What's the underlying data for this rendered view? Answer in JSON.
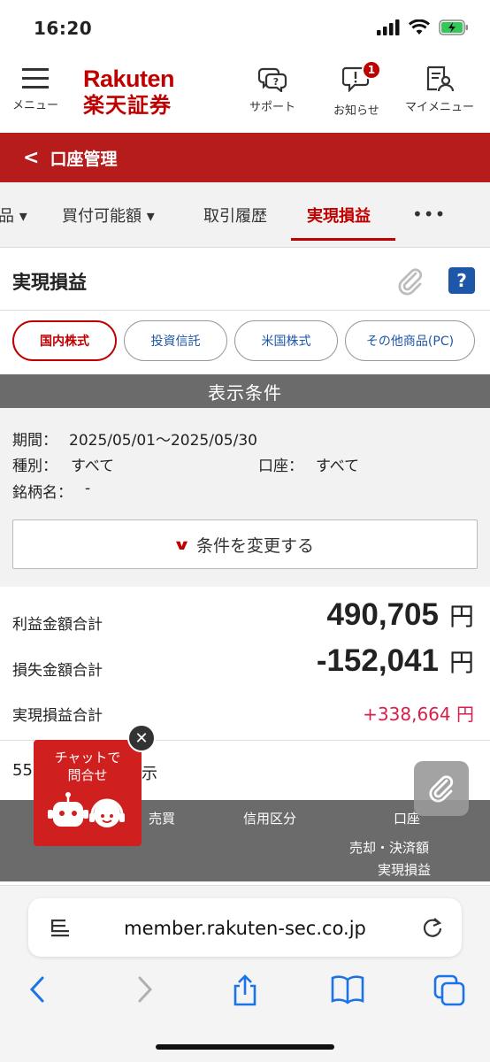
{
  "status": {
    "time": "16:20"
  },
  "header": {
    "menu_label": "メニュー",
    "logo_en": "Rakuten",
    "logo_jp": "楽天証券",
    "support_label": "サポート",
    "notice_label": "お知らせ",
    "notice_badge": "1",
    "mymenu_label": "マイメニュー"
  },
  "page_bar": {
    "title": "口座管理"
  },
  "tabs": [
    {
      "label": "品 ▾"
    },
    {
      "label": "買付可能額 ▾"
    },
    {
      "label": "取引履歴"
    },
    {
      "label": "実現損益"
    },
    {
      "label": "•••"
    }
  ],
  "section": {
    "title": "実現損益",
    "help": "?"
  },
  "chips": [
    {
      "label": "国内株式"
    },
    {
      "label": "投資信託"
    },
    {
      "label": "米国株式"
    },
    {
      "label": "その他商品(PC)"
    }
  ],
  "conditions": {
    "heading": "表示条件",
    "period_label": "期間：",
    "period_value": "2025/05/01～2025/05/30",
    "type_label": "種別：",
    "type_value": "すべて",
    "account_label": "口座：",
    "account_value": "すべて",
    "name_label": "銘柄名：",
    "name_value": "-",
    "change_button": "条件を変更する"
  },
  "totals": {
    "profit_label": "利益金額合計",
    "profit_value": "490,705",
    "loss_label": "損失金額合計",
    "loss_value": "-152,041",
    "net_label": "実現損益合計",
    "net_value": "+338,664 円",
    "unit": "円"
  },
  "list": {
    "count_prefix": "55",
    "count_suffix": "示"
  },
  "table_header": {
    "trade": "売買",
    "margin": "信用区分",
    "account": "口座",
    "amount": "売却・決済額",
    "pnl": "実現損益"
  },
  "chat": {
    "line1": "チャットで",
    "line2": "問合せ"
  },
  "browser": {
    "url": "member.rakuten-sec.co.jp"
  }
}
